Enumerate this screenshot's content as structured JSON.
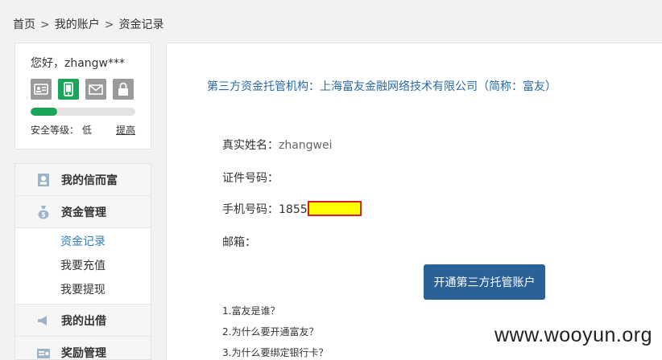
{
  "breadcrumb": {
    "home": "首页",
    "account": "我的账户",
    "current": "资金记录",
    "separator": ">"
  },
  "user_card": {
    "greeting": "您好，zhangw***",
    "security_icons": [
      "id-card-icon",
      "phone-icon",
      "mail-icon",
      "lock-icon"
    ],
    "active_icon": "phone-icon",
    "security_progress": 0.25,
    "security_level": "安全等级： 低",
    "raise_link": "提高",
    "colors": {
      "accent": "#1aa55b",
      "inactive": "#9a9a9a"
    }
  },
  "menu": {
    "items": [
      {
        "label": "我的信而富",
        "icon": "account-icon"
      },
      {
        "label": "资金管理",
        "icon": "money-bag-icon",
        "children": [
          {
            "label": "资金记录",
            "current": true
          },
          {
            "label": "我要充值"
          },
          {
            "label": "我要提现"
          }
        ]
      },
      {
        "label": "我的出借",
        "icon": "megaphone-icon"
      },
      {
        "label": "奖励管理",
        "icon": "reward-icon"
      }
    ]
  },
  "main": {
    "custodian": "第三方资金托管机构：上海富友金融网络技术有限公司（简称：富友）",
    "real_name_label": "真实姓名：",
    "real_name_value": "zhangwei",
    "id_label": "证件号码：",
    "phone_label": "手机号码：",
    "phone_prefix": "1855",
    "email_label": "邮箱：",
    "open_button": "开通第三方托管账户",
    "faq": [
      "1.富友是谁？",
      "2.为什么要开通富友？",
      "3.为什么要绑定银行卡？"
    ],
    "colors": {
      "link": "#2a6aa7",
      "button": "#2b6196",
      "redaction_fill": "#ffff00",
      "redaction_border": "#d41f1f"
    }
  },
  "watermark": "www.wooyun.org"
}
